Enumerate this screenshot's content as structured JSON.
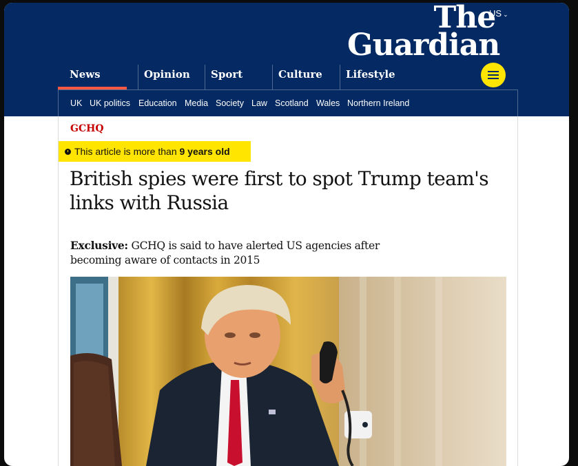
{
  "masthead": {
    "edition": "US",
    "logo_line1": "The",
    "logo_line2": "Guardian",
    "brand_color": "#052962",
    "accent_color": "#ffe500"
  },
  "nav": {
    "pillars": [
      "News",
      "Opinion",
      "Sport",
      "Culture",
      "Lifestyle"
    ],
    "active_pillar": "News",
    "menu_icon": "hamburger-menu-icon",
    "subnav": [
      "UK",
      "UK politics",
      "Education",
      "Media",
      "Society",
      "Law",
      "Scotland",
      "Wales",
      "Northern Ireland"
    ]
  },
  "article": {
    "kicker": "GCHQ",
    "age_warning_prefix": "This article is more than",
    "age_warning_age": "9 years old",
    "headline": "British spies were first to spot Trump team's links with Russia",
    "standfirst_label": "Exclusive:",
    "standfirst_text": "GCHQ is said to have alerted US agencies after becoming aware of contacts in 2015"
  }
}
